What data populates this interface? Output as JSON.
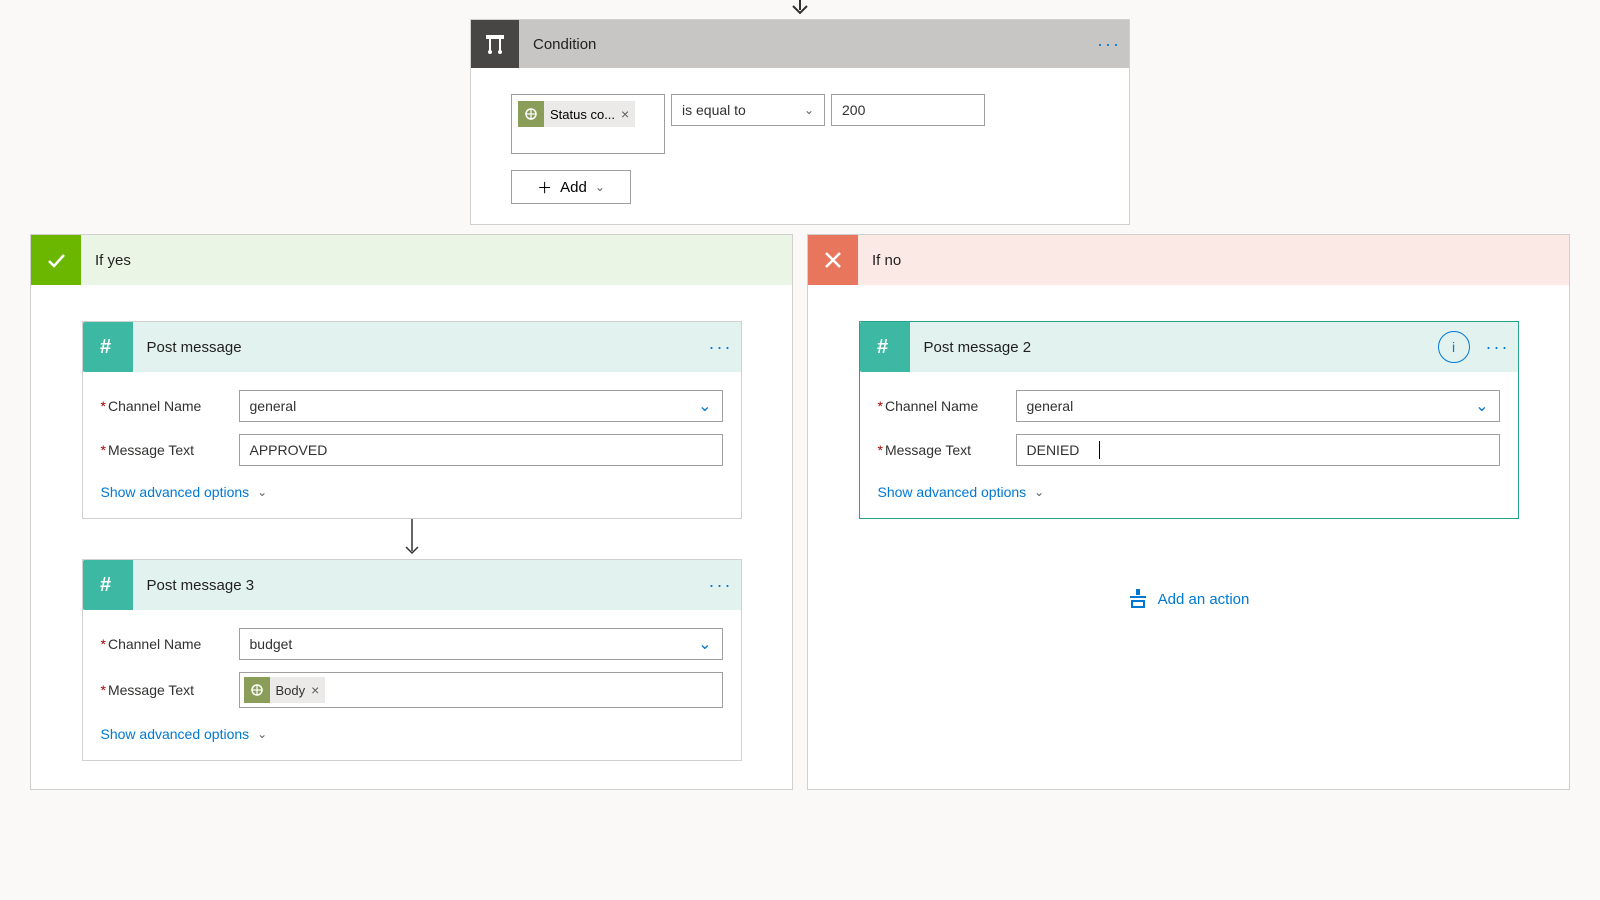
{
  "condition": {
    "title": "Condition",
    "token_label": "Status co...",
    "operator": "is equal to",
    "value": "200",
    "add_label": "Add"
  },
  "branches": {
    "yes_title": "If yes",
    "no_title": "If no"
  },
  "actions": {
    "post1": {
      "title": "Post message",
      "channel_label": "Channel Name",
      "channel_value": "general",
      "message_label": "Message Text",
      "message_value": "APPROVED",
      "advanced": "Show advanced options"
    },
    "post3": {
      "title": "Post message 3",
      "channel_label": "Channel Name",
      "channel_value": "budget",
      "message_label": "Message Text",
      "token_label": "Body",
      "advanced": "Show advanced options"
    },
    "post2": {
      "title": "Post message 2",
      "channel_label": "Channel Name",
      "channel_value": "general",
      "message_label": "Message Text",
      "message_value": "DENIED",
      "advanced": "Show advanced options"
    }
  },
  "add_action": "Add an action"
}
